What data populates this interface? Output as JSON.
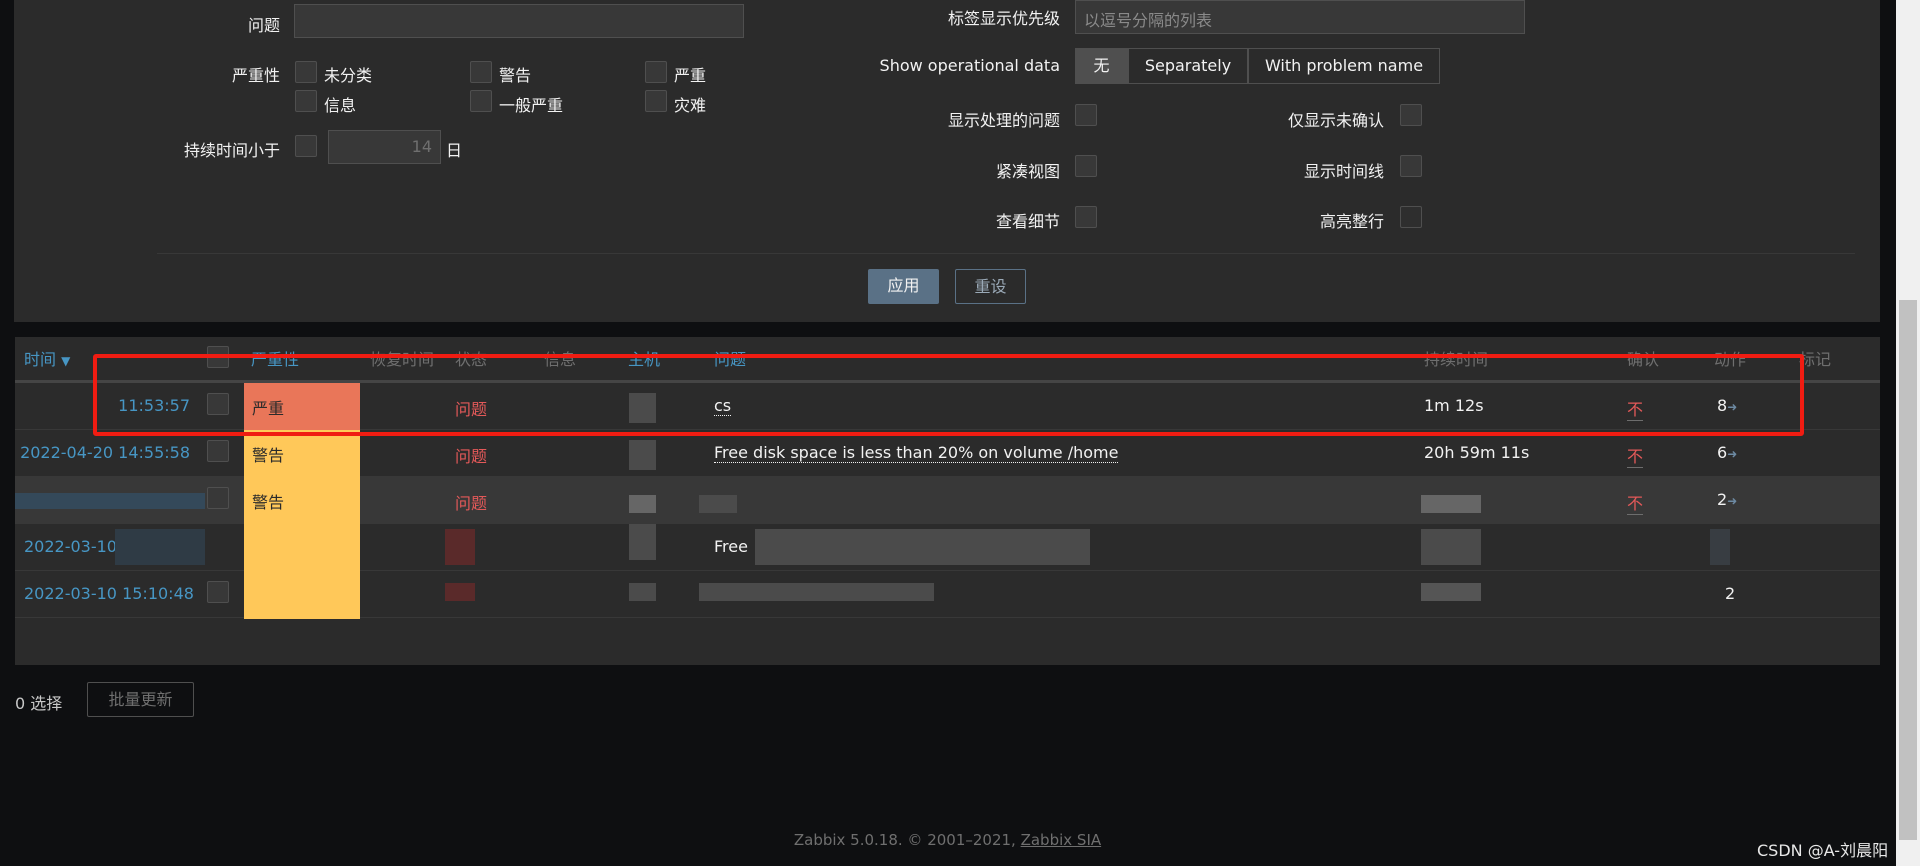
{
  "filter": {
    "problem_label": "问题",
    "problem_value": "",
    "severity_label": "严重性",
    "severities": [
      "未分类",
      "警告",
      "严重",
      "信息",
      "一般严重",
      "灾难"
    ],
    "age_label": "持续时间小于",
    "age_value": "14",
    "age_unit": "日",
    "tag_priority_label": "标签显示优先级",
    "tag_priority_placeholder": "以逗号分隔的列表",
    "opdata_label": "Show operational data",
    "opdata_options": [
      "无",
      "Separately",
      "With problem name"
    ],
    "show_suppressed": "显示处理的问题",
    "unack_only": "仅显示未确认",
    "compact_view": "紧凑视图",
    "show_timeline": "显示时间线",
    "show_details": "查看细节",
    "highlight_row": "高亮整行",
    "apply": "应用",
    "reset": "重设"
  },
  "table": {
    "headers": {
      "time": "时间",
      "severity": "严重性",
      "recovery": "恢复时间",
      "status": "状态",
      "info": "信息",
      "host": "主机",
      "problem": "问题",
      "duration": "持续时间",
      "ack": "确认",
      "actions": "动作",
      "tags": "标记"
    },
    "rows": [
      {
        "time": "11:53:57",
        "severity": "严重",
        "status": "问题",
        "problem": "cs",
        "duration": "1m 12s",
        "ack": "不",
        "actions": "8"
      },
      {
        "time": "2022-04-20 14:55:58",
        "severity": "警告",
        "status": "问题",
        "problem": "Free disk space is less than 20% on volume /home",
        "duration": "20h 59m 11s",
        "ack": "不",
        "actions": "6"
      },
      {
        "severity": "警告",
        "status": "问题",
        "ack": "不",
        "actions": "2"
      },
      {
        "time": "2022-03-10",
        "problem": "Free"
      },
      {
        "time": "2022-03-10 15:10:48",
        "actions": "2"
      }
    ]
  },
  "footer": {
    "selected": "0 选择",
    "mass_update": "批量更新",
    "copyright": "Zabbix 5.0.18. © 2001–2021, ",
    "company": "Zabbix SIA"
  },
  "watermark": "CSDN @A-刘晨阳",
  "colors": {
    "high": "#e97659",
    "warning": "#ffc859",
    "problem": "#e45959",
    "link": "#4796c4"
  }
}
